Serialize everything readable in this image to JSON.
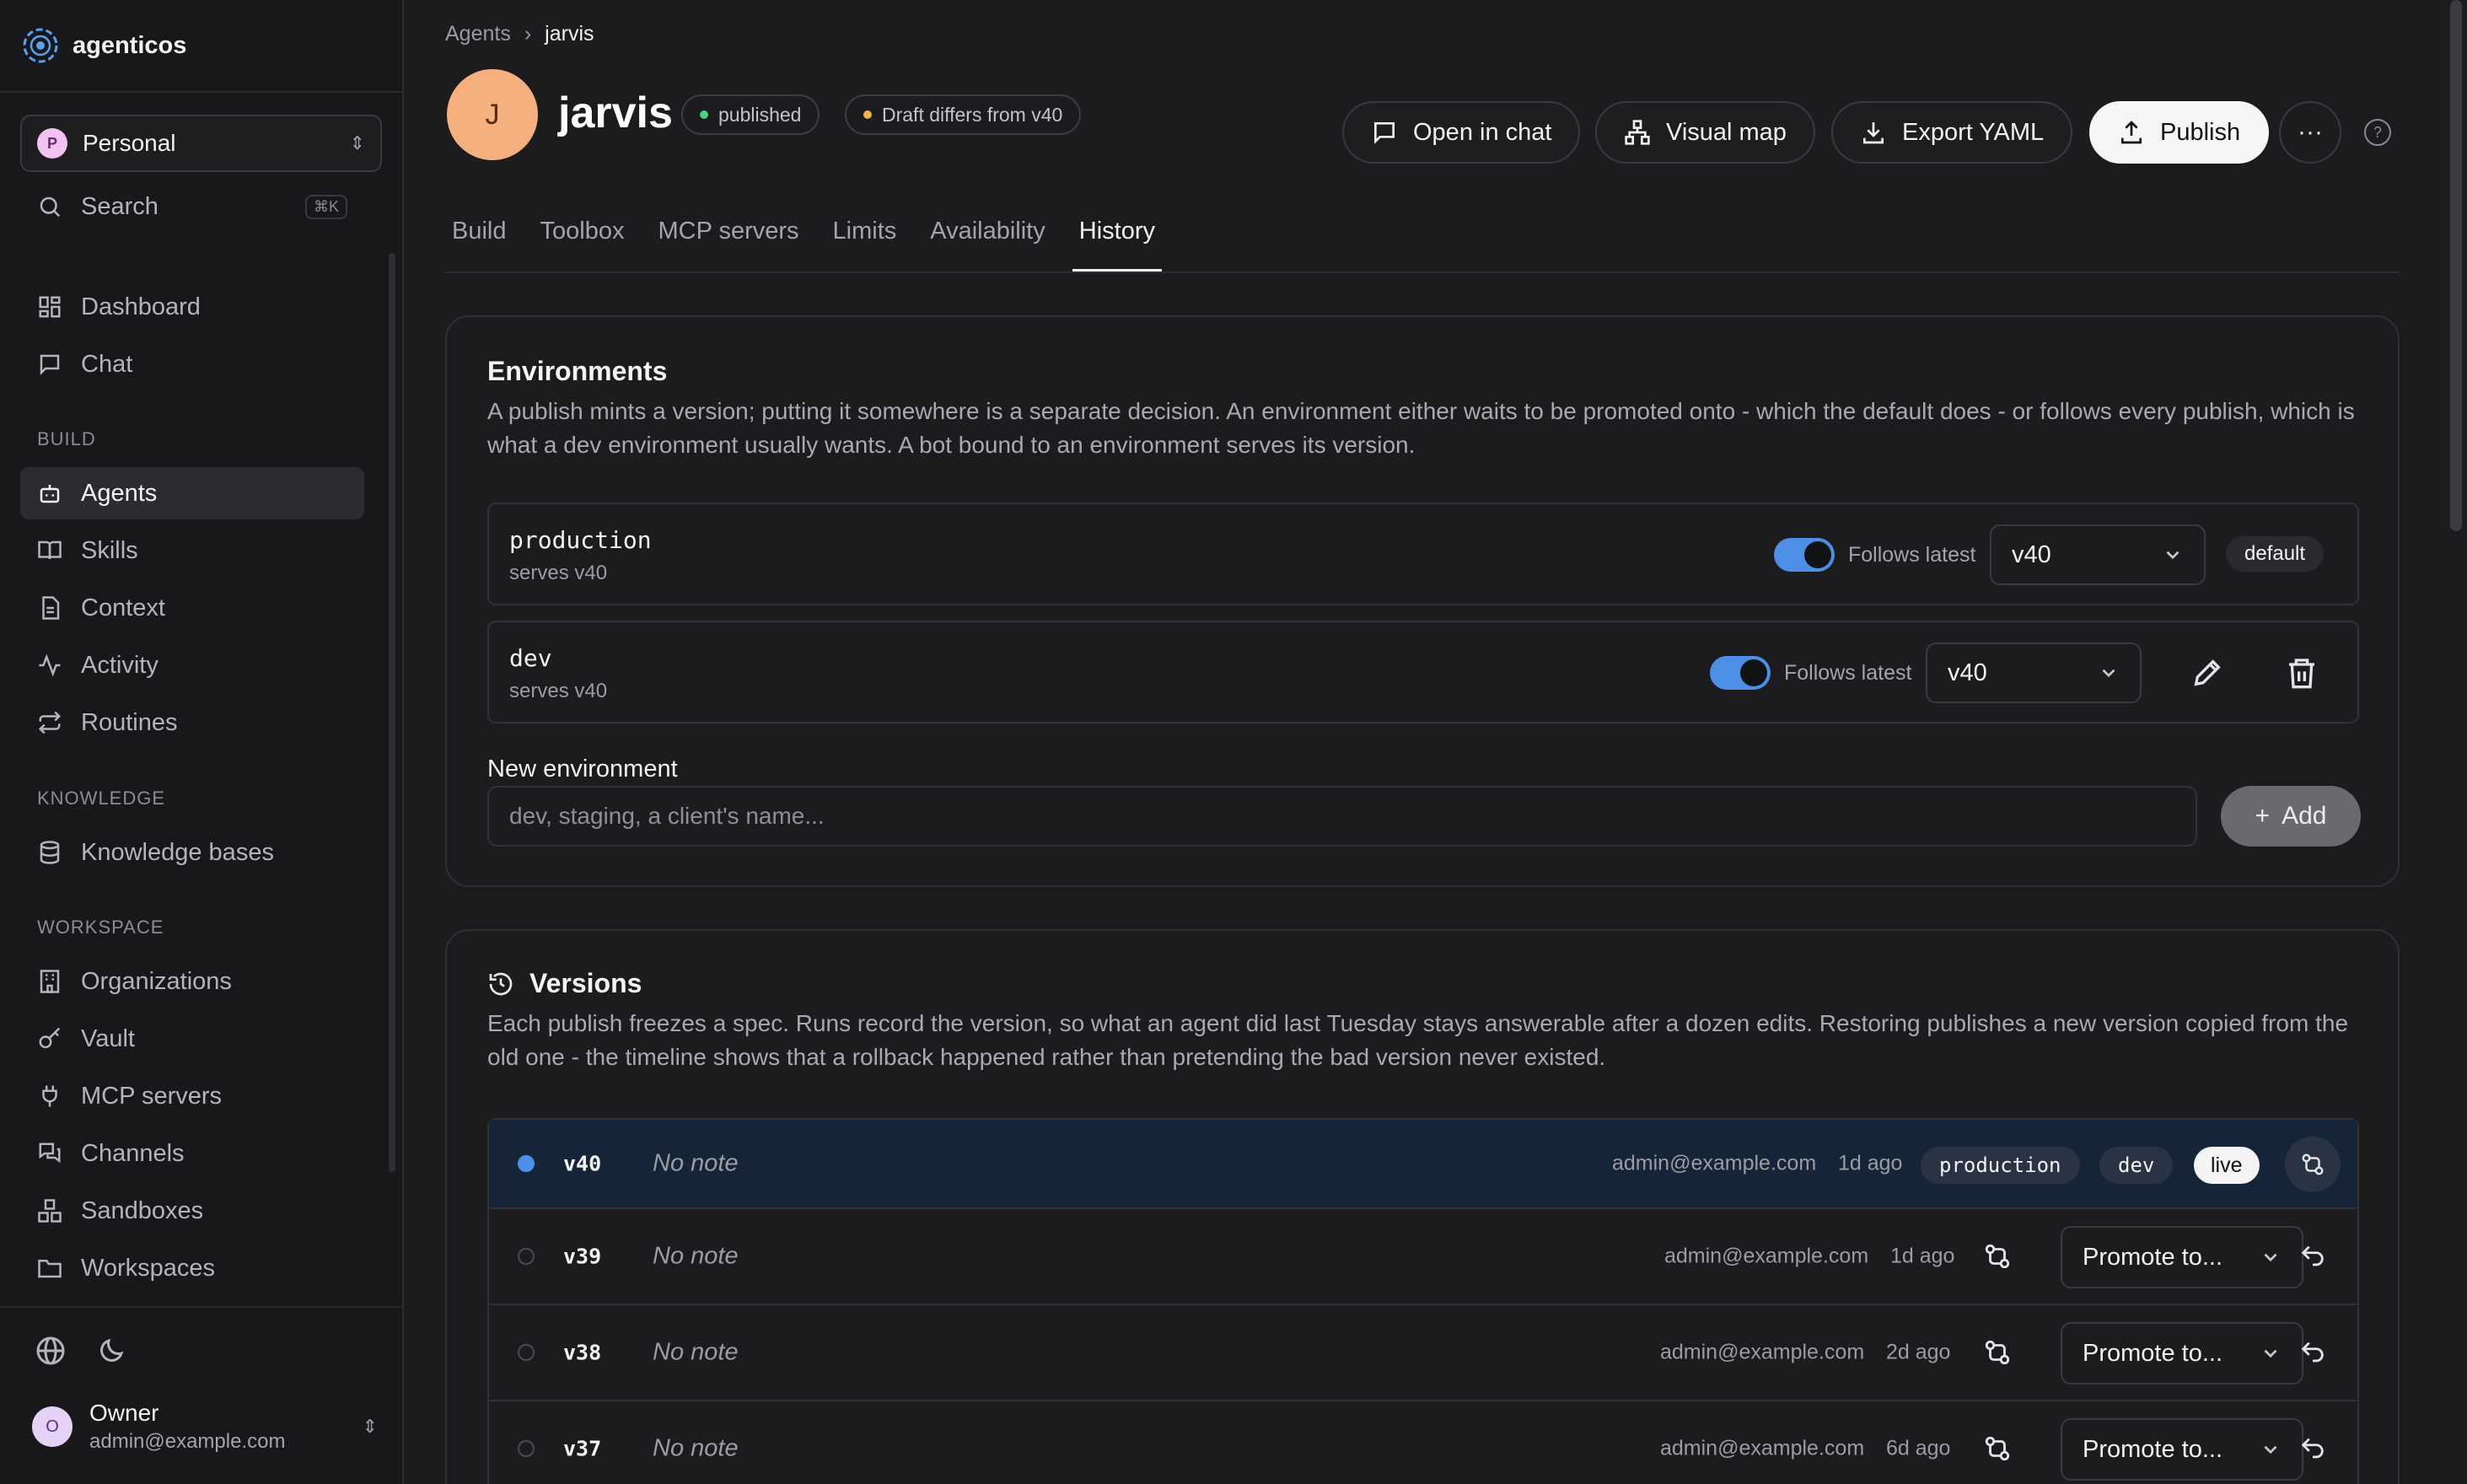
{
  "app": {
    "name": "agenticos"
  },
  "workspace": {
    "badge": "P",
    "name": "Personal"
  },
  "sidebar": {
    "search": {
      "label": "Search",
      "shortcut": "⌘K"
    },
    "top_items": [
      {
        "label": "Dashboard",
        "icon": "dashboard-icon"
      },
      {
        "label": "Chat",
        "icon": "chat-icon"
      }
    ],
    "sections": {
      "build": "BUILD",
      "knowledge": "KNOWLEDGE",
      "workspace": "WORKSPACE"
    },
    "build_items": [
      {
        "label": "Agents",
        "icon": "bot-icon",
        "active": true
      },
      {
        "label": "Skills",
        "icon": "book-icon"
      },
      {
        "label": "Context",
        "icon": "document-icon"
      },
      {
        "label": "Activity",
        "icon": "activity-icon"
      },
      {
        "label": "Routines",
        "icon": "repeat-icon"
      }
    ],
    "knowledge_items": [
      {
        "label": "Knowledge bases",
        "icon": "database-icon"
      }
    ],
    "workspace_items": [
      {
        "label": "Organizations",
        "icon": "building-icon"
      },
      {
        "label": "Vault",
        "icon": "key-icon"
      },
      {
        "label": "MCP servers",
        "icon": "plug-icon"
      },
      {
        "label": "Channels",
        "icon": "messages-icon"
      },
      {
        "label": "Sandboxes",
        "icon": "boxes-icon"
      },
      {
        "label": "Workspaces",
        "icon": "folder-icon"
      }
    ],
    "user": {
      "initial": "O",
      "name": "Owner",
      "email": "admin@example.com"
    }
  },
  "breadcrumb": {
    "parent": "Agents",
    "current": "jarvis"
  },
  "agent": {
    "initial": "J",
    "name": "jarvis",
    "status": "published",
    "draft_note": "Draft differs from v40"
  },
  "actions": {
    "open_chat": "Open in chat",
    "visual_map": "Visual map",
    "export": "Export YAML",
    "publish": "Publish"
  },
  "tabs": [
    "Build",
    "Toolbox",
    "MCP servers",
    "Limits",
    "Availability",
    "History"
  ],
  "active_tab": "History",
  "environments": {
    "title": "Environments",
    "description": "A publish mints a version; putting it somewhere is a separate decision. An environment either waits to be promoted onto - which the default does - or follows every publish, which is what a dev environment usually wants. A bot bound to an environment serves its version.",
    "rows": [
      {
        "name": "production",
        "serves": "serves v40",
        "follows_label": "Follows latest",
        "follows": true,
        "version": "v40",
        "badge": "default"
      },
      {
        "name": "dev",
        "serves": "serves v40",
        "follows_label": "Follows latest",
        "follows": true,
        "version": "v40"
      }
    ],
    "new_label": "New environment",
    "new_placeholder": "dev, staging, a client's name...",
    "add_label": "Add"
  },
  "versions": {
    "title": "Versions",
    "description": "Each publish freezes a spec. Runs record the version, so what an agent did last Tuesday stays answerable after a dozen edits. Restoring publishes a new version copied from the old one - the timeline shows that a rollback happened rather than pretending the bad version never existed.",
    "rows": [
      {
        "version": "v40",
        "note": "No note",
        "author": "admin@example.com",
        "age": "1d ago",
        "envs": [
          "production",
          "dev"
        ],
        "live": "live"
      },
      {
        "version": "v39",
        "note": "No note",
        "author": "admin@example.com",
        "age": "1d ago",
        "promote": "Promote to..."
      },
      {
        "version": "v38",
        "note": "No note",
        "author": "admin@example.com",
        "age": "2d ago",
        "promote": "Promote to..."
      },
      {
        "version": "v37",
        "note": "No note",
        "author": "admin@example.com",
        "age": "6d ago",
        "promote": "Promote to..."
      }
    ]
  },
  "colors": {
    "accent": "#4d8fe6",
    "avatar": "#f6b07e",
    "published_dot": "#4ad17a",
    "draft_dot": "#f0b44c"
  }
}
